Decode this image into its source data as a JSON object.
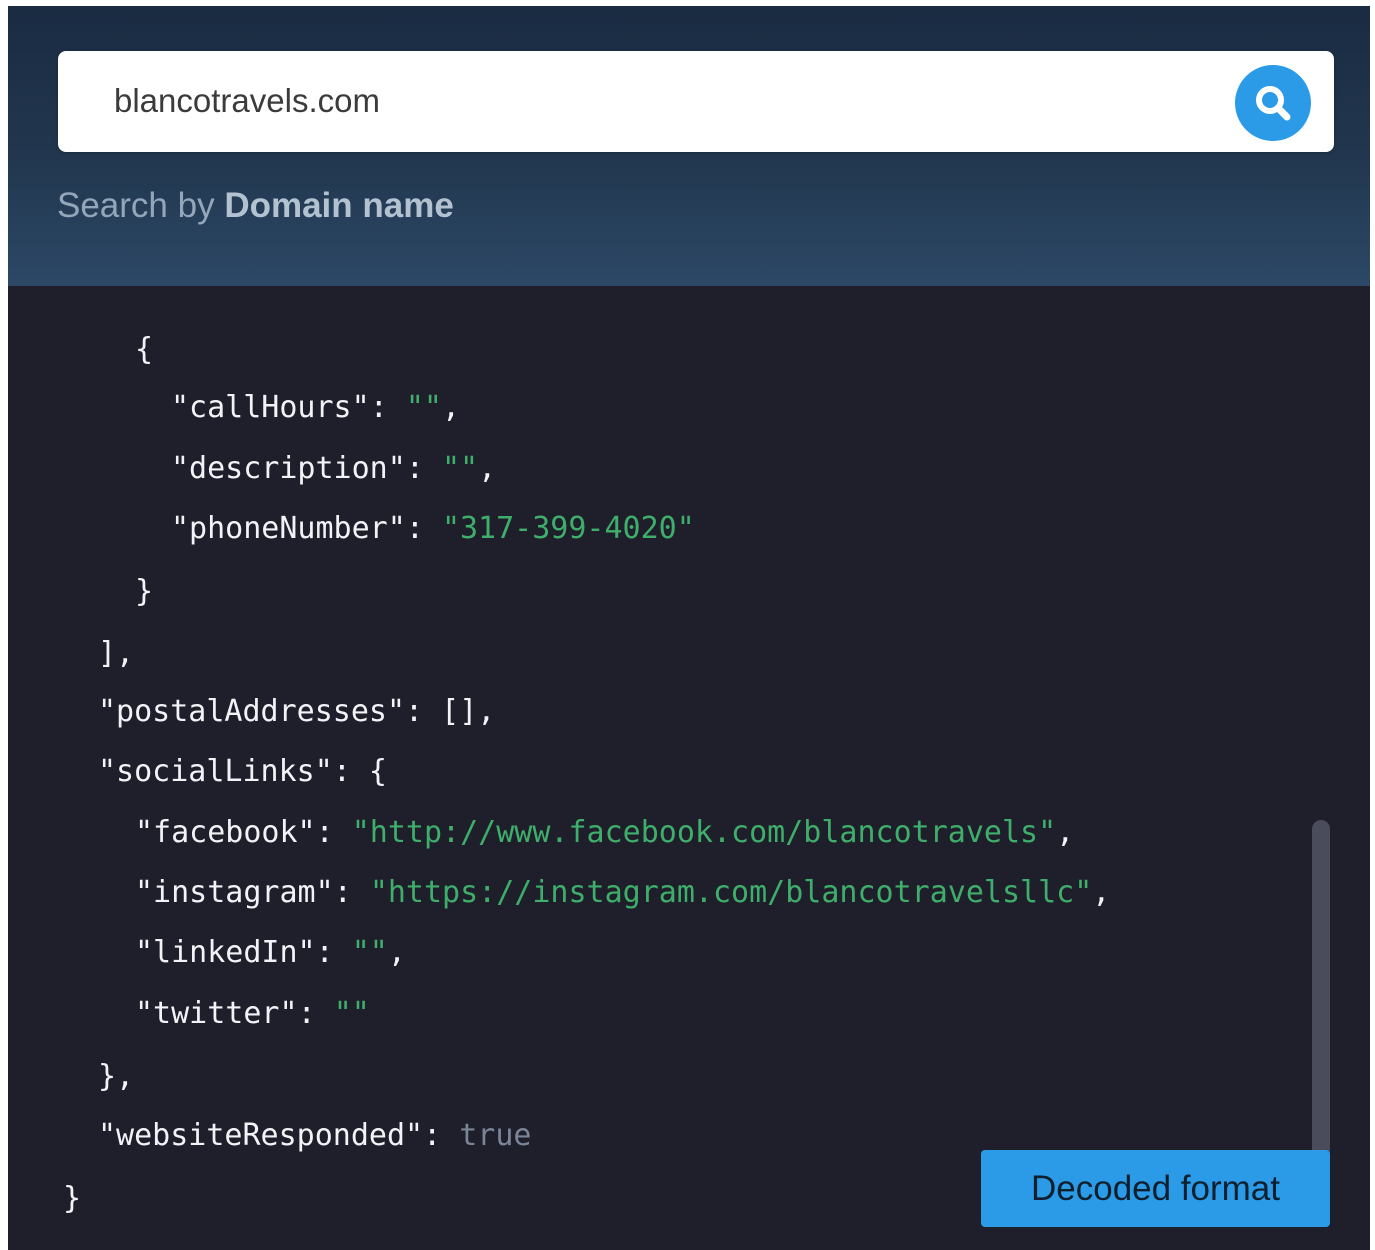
{
  "search": {
    "value": "blancotravels.com",
    "hint_prefix": "Search by ",
    "hint_bold": "Domain name",
    "icon": "search-icon",
    "accent_color": "#2b9be8"
  },
  "json_view": {
    "lines": [
      {
        "segments": [
          {
            "cls": "punct",
            "text": "{"
          }
        ]
      },
      {
        "segments": [
          {
            "cls": "key",
            "text": "\"callHours\""
          },
          {
            "cls": "punct",
            "text": ": "
          },
          {
            "cls": "str",
            "text": "\"\""
          },
          {
            "cls": "punct",
            "text": ","
          }
        ]
      },
      {
        "segments": [
          {
            "cls": "key",
            "text": "\"description\""
          },
          {
            "cls": "punct",
            "text": ": "
          },
          {
            "cls": "str",
            "text": "\"\""
          },
          {
            "cls": "punct",
            "text": ","
          }
        ]
      },
      {
        "segments": [
          {
            "cls": "key",
            "text": "\"phoneNumber\""
          },
          {
            "cls": "punct",
            "text": ": "
          },
          {
            "cls": "str",
            "text": "\"317-399-4020\""
          }
        ]
      },
      {
        "segments": [
          {
            "cls": "punct",
            "text": "}"
          }
        ]
      },
      {
        "segments": [
          {
            "cls": "punct",
            "text": "],"
          }
        ]
      },
      {
        "segments": [
          {
            "cls": "key",
            "text": "\"postalAddresses\""
          },
          {
            "cls": "punct",
            "text": ": [],"
          }
        ]
      },
      {
        "segments": [
          {
            "cls": "key",
            "text": "\"socialLinks\""
          },
          {
            "cls": "punct",
            "text": ": {"
          }
        ]
      },
      {
        "segments": [
          {
            "cls": "key",
            "text": "\"facebook\""
          },
          {
            "cls": "punct",
            "text": ": "
          },
          {
            "cls": "str",
            "text": "\"http://www.facebook.com/blancotravels\""
          },
          {
            "cls": "punct",
            "text": ","
          }
        ]
      },
      {
        "segments": [
          {
            "cls": "key",
            "text": "\"instagram\""
          },
          {
            "cls": "punct",
            "text": ": "
          },
          {
            "cls": "str",
            "text": "\"https://instagram.com/blancotravelsllc\""
          },
          {
            "cls": "punct",
            "text": ","
          }
        ]
      },
      {
        "segments": [
          {
            "cls": "key",
            "text": "\"linkedIn\""
          },
          {
            "cls": "punct",
            "text": ": "
          },
          {
            "cls": "str",
            "text": "\"\""
          },
          {
            "cls": "punct",
            "text": ","
          }
        ]
      },
      {
        "segments": [
          {
            "cls": "key",
            "text": "\"twitter\""
          },
          {
            "cls": "punct",
            "text": ": "
          },
          {
            "cls": "str",
            "text": "\"\""
          }
        ]
      },
      {
        "segments": [
          {
            "cls": "punct",
            "text": "},"
          }
        ]
      },
      {
        "segments": [
          {
            "cls": "key",
            "text": "\"websiteResponded\""
          },
          {
            "cls": "punct",
            "text": ": "
          },
          {
            "cls": "bool",
            "text": "true"
          }
        ]
      },
      {
        "segments": [
          {
            "cls": "punct",
            "text": "}"
          }
        ]
      }
    ]
  },
  "decoded_button": {
    "label": "Decoded format"
  }
}
